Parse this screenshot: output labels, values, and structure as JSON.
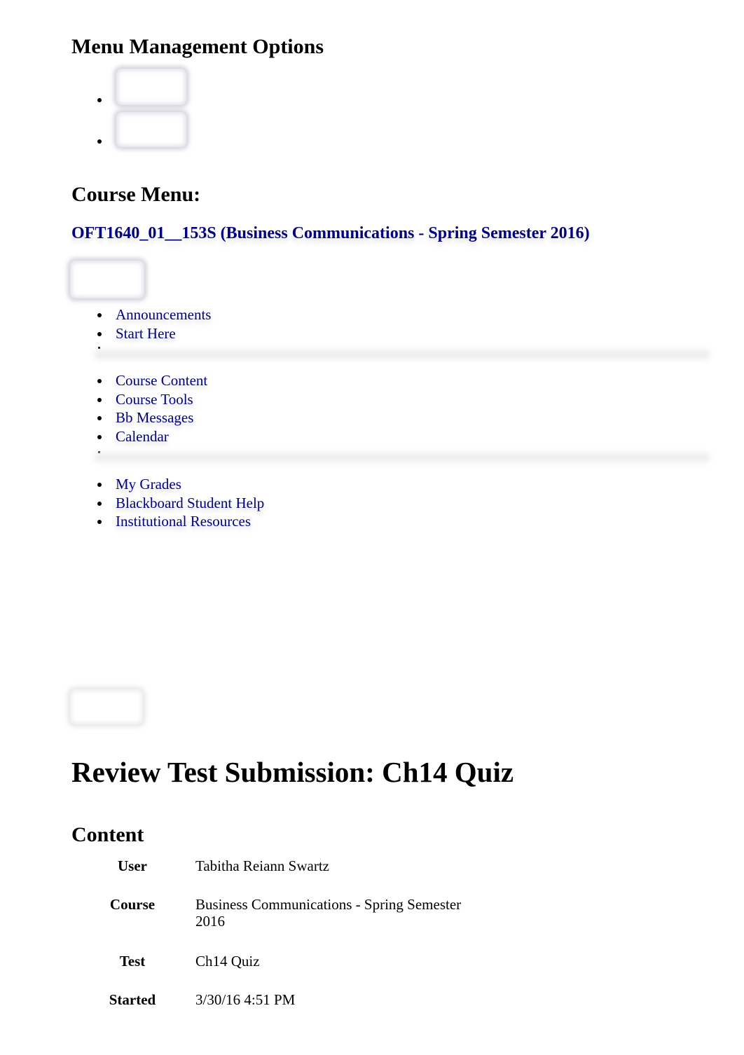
{
  "menu_management": {
    "title": "Menu Management Options",
    "buttons": [
      {
        "icon": "menu-option-button"
      },
      {
        "icon": "menu-option-button"
      }
    ]
  },
  "course_menu": {
    "title": "Course Menu:",
    "course_link": "OFT1640_01__153S (Business Communications - Spring Semester 2016)",
    "groups": [
      [
        "Announcements",
        "Start Here"
      ],
      [
        "Course Content",
        "Course Tools",
        "Bb Messages",
        "Calendar"
      ],
      [
        "My Grades",
        "Blackboard Student Help",
        "Institutional Resources"
      ]
    ]
  },
  "review": {
    "title": "Review Test Submission: Ch14 Quiz",
    "content_heading": "Content",
    "details": [
      {
        "label": "User",
        "value": "Tabitha Reiann Swartz"
      },
      {
        "label": "Course",
        "value": "Business Communications - Spring Semester 2016"
      },
      {
        "label": "Test",
        "value": "Ch14 Quiz"
      },
      {
        "label": "Started",
        "value": "3/30/16 4:51 PM"
      }
    ]
  },
  "colors": {
    "link": "#000080",
    "text": "#000000",
    "background": "#ffffff"
  }
}
